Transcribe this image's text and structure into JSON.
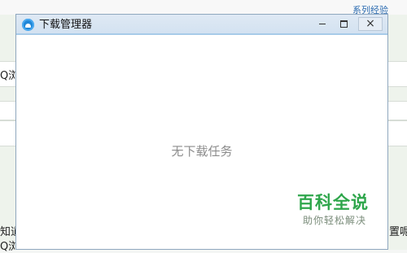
{
  "background": {
    "top_link": "系列经验",
    "left_fragments": [
      "Q浏",
      "知道",
      "Q浏"
    ],
    "right_fragment": "置呢"
  },
  "window": {
    "title": "下载管理器",
    "icon": "download-manager-app-icon",
    "controls": {
      "minimize": "minimize-icon",
      "maximize": "maximize-icon",
      "close": "×"
    },
    "empty_message": "无下载任务"
  },
  "watermark": {
    "title": "百科全说",
    "subtitle": "助你轻松解决"
  },
  "colors": {
    "titlebar": "#d9e6f3",
    "accent_line": "#a7cbe9",
    "watermark_green": "#2ea64b"
  }
}
